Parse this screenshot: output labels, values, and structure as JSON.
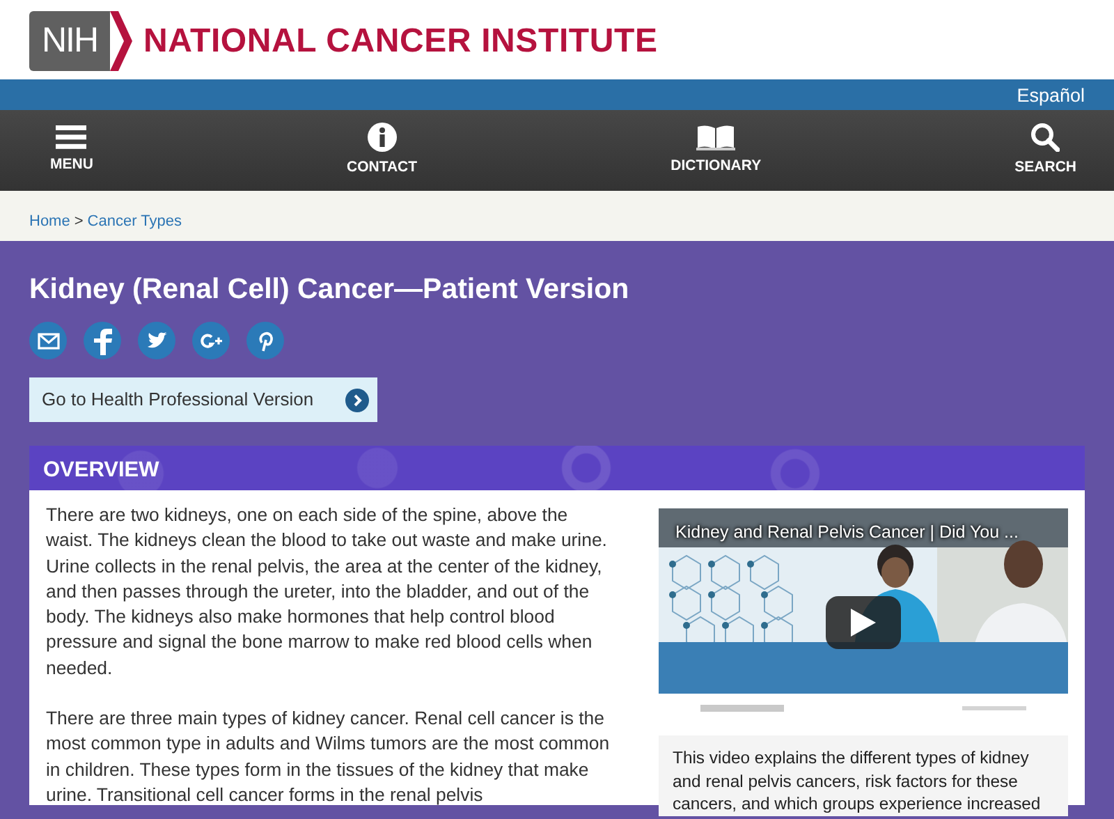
{
  "header": {
    "logo_badge": "NIH",
    "logo_text": "NATIONAL CANCER INSTITUTE"
  },
  "language_link": "Español",
  "nav": [
    {
      "label": "MENU",
      "kind": "menu"
    },
    {
      "label": "CONTACT",
      "kind": "info"
    },
    {
      "label": "DICTIONARY",
      "kind": "book"
    },
    {
      "label": "SEARCH",
      "kind": "search"
    }
  ],
  "breadcrumb": {
    "items": [
      "Home",
      "Cancer Types"
    ],
    "separator": ">"
  },
  "page_title": "Kidney (Renal Cell) Cancer—Patient Version",
  "share_buttons": [
    {
      "kind": "email"
    },
    {
      "kind": "facebook"
    },
    {
      "kind": "twitter"
    },
    {
      "kind": "googleplus"
    },
    {
      "kind": "pinterest"
    }
  ],
  "professional_link": "Go to Health Professional Version",
  "section": {
    "title": "OVERVIEW",
    "paragraphs": [
      "There are two kidneys, one on each side of the spine, above the waist. The kidneys clean the blood to take out waste and make urine. Urine collects in the renal pelvis, the area at the center of the kidney, and then passes through the ureter, into the bladder, and out of the body. The kidneys also make hormones that help control blood pressure and signal the bone marrow to make red blood cells when needed.",
      "There are three main types of kidney cancer. Renal cell cancer is the most common type in adults and Wilms tumors are the most common in children. These types form in the tissues of the kidney that make urine. Transitional cell cancer forms in the renal pelvis"
    ]
  },
  "video": {
    "title": "Kidney and Renal Pelvis Cancer | Did You ...",
    "kind": "picture"
  },
  "video_caption": "This video explains the different types of kidney and renal pelvis cancers, risk factors for these cancers, and which groups experience increased"
}
